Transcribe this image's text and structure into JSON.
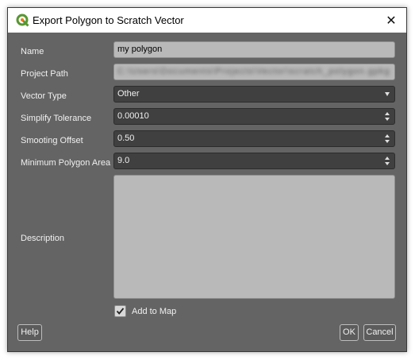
{
  "window": {
    "title": "Export Polygon to Scratch Vector",
    "close_symbol": "✕"
  },
  "form": {
    "name": {
      "label": "Name",
      "value": "my polygon"
    },
    "project_path": {
      "label": "Project Path",
      "value": "C:\\Users\\Documents\\Projects\\Vector\\scratch_polygon.gpkg"
    },
    "vector_type": {
      "label": "Vector Type",
      "value": "Other"
    },
    "simplify_tolerance": {
      "label": "Simplify Tolerance",
      "value": "0.00010"
    },
    "smoothing_offset": {
      "label": "Smooting Offset",
      "value": "0.50"
    },
    "minimum_polygon_area": {
      "label": "Minimum Polygon Area",
      "value": "9.0"
    },
    "description": {
      "label": "Description",
      "value": ""
    },
    "add_to_map": {
      "label": "Add to Map",
      "checked": true
    }
  },
  "buttons": {
    "help": "Help",
    "ok": "OK",
    "cancel": "Cancel"
  },
  "colors": {
    "dialog_bg": "#646464",
    "light_field": "#b9b9b9",
    "dark_field": "#404040",
    "qgis_green": "#589632"
  }
}
